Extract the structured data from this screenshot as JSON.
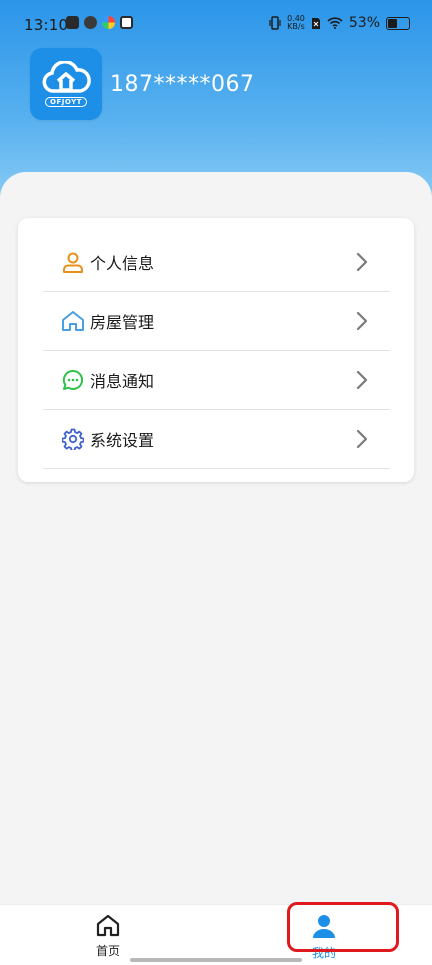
{
  "status_bar": {
    "time": "13:10",
    "network_speed_value": "0.40",
    "network_speed_unit": "KB/s",
    "battery_percent": "53%"
  },
  "profile": {
    "logo_text": "OFJOYT",
    "phone": "187*****067"
  },
  "menu": {
    "items": [
      {
        "label": "个人信息",
        "icon": "person-icon",
        "color": "#e8901c"
      },
      {
        "label": "房屋管理",
        "icon": "house-icon",
        "color": "#4a9fe0"
      },
      {
        "label": "消息通知",
        "icon": "chat-bubble-icon",
        "color": "#2ec24a"
      },
      {
        "label": "系统设置",
        "icon": "gear-icon",
        "color": "#3f63c8"
      }
    ]
  },
  "tabbar": {
    "home_label": "首页",
    "mine_label": "我的",
    "active_color": "#1d8fe6"
  },
  "annotation": {
    "highlight_color": "#e0191e"
  }
}
